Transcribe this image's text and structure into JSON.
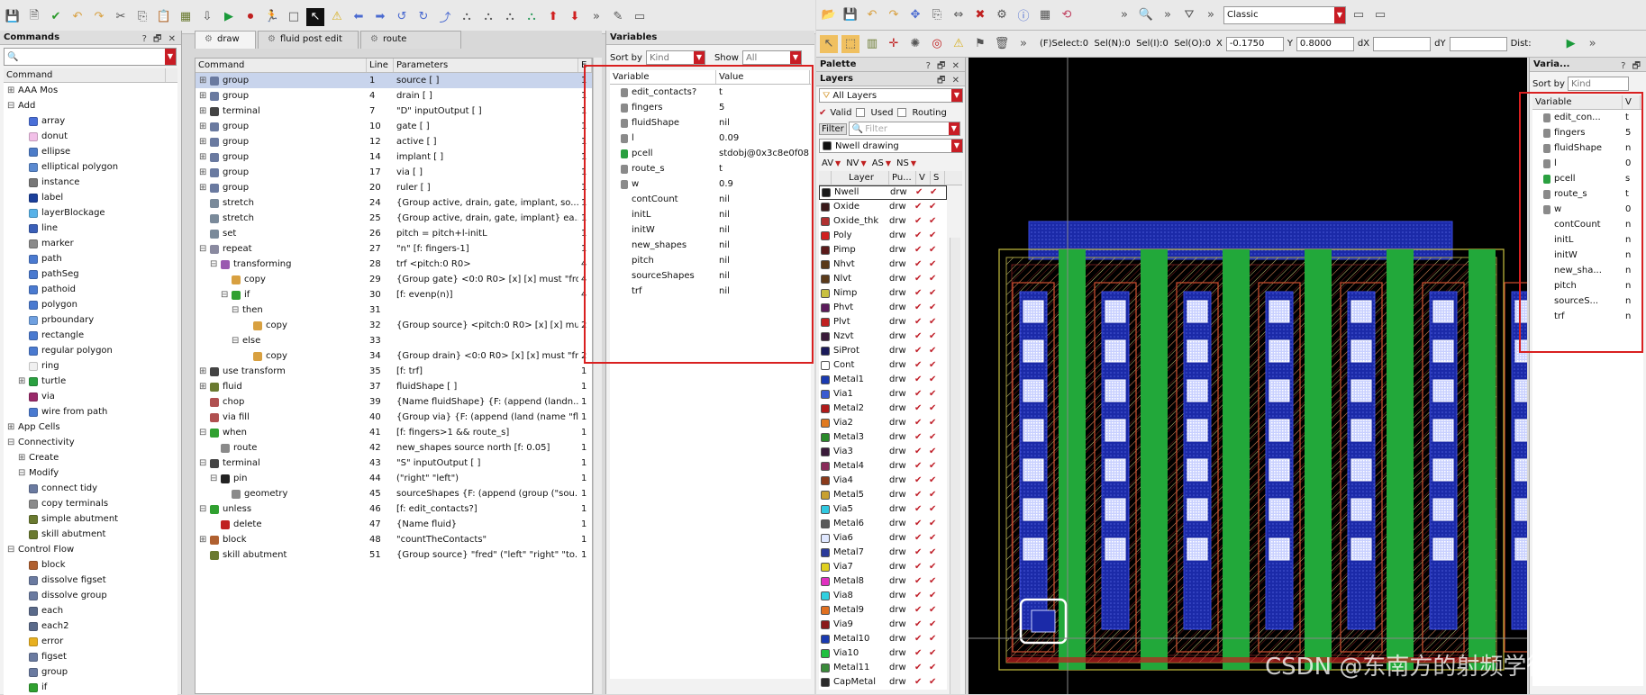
{
  "colors": {
    "accent_red": "#d92020",
    "canvas_bg": "#000000",
    "green_layer": "#22a83a",
    "blue_layer": "#1b2aa8"
  },
  "commands_panel": {
    "title": "Commands",
    "search_placeholder": "",
    "column": "Command",
    "items": [
      {
        "label": "AAA Mos",
        "indent": 0,
        "exp": "+",
        "icon": ""
      },
      {
        "label": "Add",
        "indent": 0,
        "exp": "−",
        "icon": ""
      },
      {
        "label": "array",
        "indent": 2,
        "exp": "",
        "icon": "#4a6fd8"
      },
      {
        "label": "donut",
        "indent": 2,
        "exp": "",
        "icon": "#f2c0e8"
      },
      {
        "label": "ellipse",
        "indent": 2,
        "exp": "",
        "icon": "#4d7cc8"
      },
      {
        "label": "elliptical polygon",
        "indent": 2,
        "exp": "",
        "icon": "#5b8ad0"
      },
      {
        "label": "instance",
        "indent": 2,
        "exp": "",
        "icon": "#777777"
      },
      {
        "label": "label",
        "indent": 2,
        "exp": "",
        "icon": "#1b3f9a"
      },
      {
        "label": "layerBlockage",
        "indent": 2,
        "exp": "",
        "icon": "#58b2e8"
      },
      {
        "label": "line",
        "indent": 2,
        "exp": "",
        "icon": "#3a5fb8"
      },
      {
        "label": "marker",
        "indent": 2,
        "exp": "",
        "icon": "#8a8a8a"
      },
      {
        "label": "path",
        "indent": 2,
        "exp": "",
        "icon": "#4a7ad0"
      },
      {
        "label": "pathSeg",
        "indent": 2,
        "exp": "",
        "icon": "#4a7ad0"
      },
      {
        "label": "pathoid",
        "indent": 2,
        "exp": "",
        "icon": "#4a7ad0"
      },
      {
        "label": "polygon",
        "indent": 2,
        "exp": "",
        "icon": "#4a7ad0"
      },
      {
        "label": "prboundary",
        "indent": 2,
        "exp": "",
        "icon": "#6fa0e0"
      },
      {
        "label": "rectangle",
        "indent": 2,
        "exp": "",
        "icon": "#4a7ad0"
      },
      {
        "label": "regular polygon",
        "indent": 2,
        "exp": "",
        "icon": "#4a7ad0"
      },
      {
        "label": "ring",
        "indent": 2,
        "exp": "",
        "icon": "#f0f0f0"
      },
      {
        "label": "turtle",
        "indent": 1,
        "exp": "+",
        "icon": "#2aa040"
      },
      {
        "label": "via",
        "indent": 2,
        "exp": "",
        "icon": "#9a2a6a"
      },
      {
        "label": "wire from path",
        "indent": 2,
        "exp": "",
        "icon": "#4a7ad0"
      },
      {
        "label": "App Cells",
        "indent": 0,
        "exp": "+",
        "icon": ""
      },
      {
        "label": "Connectivity",
        "indent": 0,
        "exp": "−",
        "icon": ""
      },
      {
        "label": "Create",
        "indent": 1,
        "exp": "+",
        "icon": ""
      },
      {
        "label": "Modify",
        "indent": 1,
        "exp": "−",
        "icon": ""
      },
      {
        "label": "connect tidy",
        "indent": 2,
        "exp": "",
        "icon": "#6a7aa0"
      },
      {
        "label": "copy terminals",
        "indent": 2,
        "exp": "",
        "icon": "#8a8a8a"
      },
      {
        "label": "simple abutment",
        "indent": 2,
        "exp": "",
        "icon": "#6a7a30"
      },
      {
        "label": "skill abutment",
        "indent": 2,
        "exp": "",
        "icon": "#6a7a30"
      },
      {
        "label": "Control Flow",
        "indent": 0,
        "exp": "−",
        "icon": ""
      },
      {
        "label": "block",
        "indent": 2,
        "exp": "",
        "icon": "#b06030"
      },
      {
        "label": "dissolve figset",
        "indent": 2,
        "exp": "",
        "icon": "#6a7aa0"
      },
      {
        "label": "dissolve group",
        "indent": 2,
        "exp": "",
        "icon": "#6a7aa0"
      },
      {
        "label": "each",
        "indent": 2,
        "exp": "",
        "icon": "#5a6a8a"
      },
      {
        "label": "each2",
        "indent": 2,
        "exp": "",
        "icon": "#5a6a8a"
      },
      {
        "label": "error",
        "indent": 2,
        "exp": "",
        "icon": "#e8b020"
      },
      {
        "label": "figset",
        "indent": 2,
        "exp": "",
        "icon": "#6a7aa0"
      },
      {
        "label": "group",
        "indent": 2,
        "exp": "",
        "icon": "#6a7aa0"
      },
      {
        "label": "if",
        "indent": 2,
        "exp": "",
        "icon": "#30a030"
      }
    ]
  },
  "tabs": [
    {
      "label": "draw",
      "active": true
    },
    {
      "label": "fluid post edit",
      "active": false
    },
    {
      "label": "route",
      "active": false
    }
  ],
  "command_table": {
    "columns": [
      "Command",
      "Line",
      "Parameters",
      "E"
    ],
    "rows": [
      {
        "cmd": "group",
        "indent": 0,
        "exp": "+",
        "line": "1",
        "params": "source [ ]",
        "e": "1",
        "sel": true,
        "icon": "#6a7aa0"
      },
      {
        "cmd": "group",
        "indent": 0,
        "exp": "+",
        "line": "4",
        "params": "drain [ ]",
        "e": "1",
        "icon": "#6a7aa0"
      },
      {
        "cmd": "terminal",
        "indent": 0,
        "exp": "+",
        "line": "7",
        "params": "\"D\" inputOutput [ ]",
        "e": "1",
        "icon": "#444444"
      },
      {
        "cmd": "group",
        "indent": 0,
        "exp": "+",
        "line": "10",
        "params": "gate [ ]",
        "e": "1",
        "icon": "#6a7aa0"
      },
      {
        "cmd": "group",
        "indent": 0,
        "exp": "+",
        "line": "12",
        "params": "active [ ]",
        "e": "1",
        "icon": "#6a7aa0"
      },
      {
        "cmd": "group",
        "indent": 0,
        "exp": "+",
        "line": "14",
        "params": "implant [ ]",
        "e": "1",
        "icon": "#6a7aa0"
      },
      {
        "cmd": "group",
        "indent": 0,
        "exp": "+",
        "line": "17",
        "params": "via [ ]",
        "e": "1",
        "icon": "#6a7aa0"
      },
      {
        "cmd": "group",
        "indent": 0,
        "exp": "+",
        "line": "20",
        "params": "ruler [ ]",
        "e": "1",
        "icon": "#6a7aa0"
      },
      {
        "cmd": "stretch",
        "indent": 0,
        "exp": "",
        "line": "24",
        "params": "{Group active, drain, gate, implant, so...",
        "e": "1",
        "icon": "#7a8a9a"
      },
      {
        "cmd": "stretch",
        "indent": 0,
        "exp": "",
        "line": "25",
        "params": "{Group active, drain, gate, implant} ea...",
        "e": "1",
        "icon": "#7a8a9a"
      },
      {
        "cmd": "set",
        "indent": 0,
        "exp": "",
        "line": "26",
        "params": "pitch = pitch+l-initL",
        "e": "1",
        "icon": "#7a8a9a"
      },
      {
        "cmd": "repeat",
        "indent": 0,
        "exp": "−",
        "line": "27",
        "params": "\"n\" [f: fingers-1]",
        "e": "1",
        "icon": "#8a8aa0"
      },
      {
        "cmd": "transforming",
        "indent": 1,
        "exp": "−",
        "line": "28",
        "params": "trf <pitch:0 R0>",
        "e": "4",
        "icon": "#9a5ab0"
      },
      {
        "cmd": "copy",
        "indent": 2,
        "exp": "",
        "line": "29",
        "params": "{Group gate} <0:0 R0> [x] [x] must \"fro...",
        "e": "4",
        "icon": "#d8a040"
      },
      {
        "cmd": "if",
        "indent": 2,
        "exp": "−",
        "line": "30",
        "params": "[f: evenp(n)]",
        "e": "4",
        "icon": "#30a030"
      },
      {
        "cmd": "then",
        "indent": 3,
        "exp": "−",
        "line": "31",
        "params": "",
        "e": "",
        "icon": ""
      },
      {
        "cmd": "copy",
        "indent": 4,
        "exp": "",
        "line": "32",
        "params": "{Group source} <pitch:0 R0> [x] [x] mu...",
        "e": "2",
        "icon": "#d8a040"
      },
      {
        "cmd": "else",
        "indent": 3,
        "exp": "−",
        "line": "33",
        "params": "",
        "e": "",
        "icon": ""
      },
      {
        "cmd": "copy",
        "indent": 4,
        "exp": "",
        "line": "34",
        "params": "{Group drain} <0:0 R0> [x] [x] must \"fr...",
        "e": "2",
        "icon": "#d8a040"
      },
      {
        "cmd": "use transform",
        "indent": 0,
        "exp": "+",
        "line": "35",
        "params": "[f: trf]",
        "e": "1",
        "icon": "#444444"
      },
      {
        "cmd": "fluid",
        "indent": 0,
        "exp": "+",
        "line": "37",
        "params": "fluidShape [ ]",
        "e": "1",
        "icon": "#6a7a30"
      },
      {
        "cmd": "chop",
        "indent": 0,
        "exp": "",
        "line": "39",
        "params": "{Name fluidShape} {F: (append (landn...",
        "e": "1",
        "icon": "#b05050"
      },
      {
        "cmd": "via fill",
        "indent": 0,
        "exp": "",
        "line": "40",
        "params": "{Group via} {F: (append (land (name \"fl...",
        "e": "1",
        "icon": "#b05050"
      },
      {
        "cmd": "when",
        "indent": 0,
        "exp": "−",
        "line": "41",
        "params": "[f: fingers>1 && route_s]",
        "e": "1",
        "icon": "#30a030"
      },
      {
        "cmd": "route",
        "indent": 1,
        "exp": "",
        "line": "42",
        "params": "new_shapes source north [f: 0.05]",
        "e": "1",
        "icon": "#8a8a8a"
      },
      {
        "cmd": "terminal",
        "indent": 0,
        "exp": "−",
        "line": "43",
        "params": "\"S\" inputOutput [ ]",
        "e": "1",
        "icon": "#444444"
      },
      {
        "cmd": "pin",
        "indent": 1,
        "exp": "−",
        "line": "44",
        "params": "(\"right\" \"left\")",
        "e": "1",
        "icon": "#222222"
      },
      {
        "cmd": "geometry",
        "indent": 2,
        "exp": "",
        "line": "45",
        "params": "sourceShapes {F: (append (group (\"sou...",
        "e": "1",
        "icon": "#8a8a8a"
      },
      {
        "cmd": "unless",
        "indent": 0,
        "exp": "−",
        "line": "46",
        "params": "[f: edit_contacts?]",
        "e": "1",
        "icon": "#30a030"
      },
      {
        "cmd": "delete",
        "indent": 1,
        "exp": "",
        "line": "47",
        "params": "{Name fluid}",
        "e": "1",
        "icon": "#c02020"
      },
      {
        "cmd": "block",
        "indent": 0,
        "exp": "+",
        "line": "48",
        "params": "\"countTheContacts\"",
        "e": "1",
        "icon": "#b06030"
      },
      {
        "cmd": "skill abutment",
        "indent": 0,
        "exp": "",
        "line": "51",
        "params": "{Group source} \"fred\" (\"left\" \"right\" \"to...",
        "e": "1",
        "icon": "#6a7a30"
      }
    ]
  },
  "variables_panel": {
    "title": "Variables",
    "sort_label": "Sort by",
    "sort_value": "Kind",
    "show_label": "Show",
    "show_value": "All",
    "columns": [
      "Variable",
      "Value"
    ],
    "rows": [
      {
        "name": "edit_contacts?",
        "value": "t",
        "icon": "#8a8a8a"
      },
      {
        "name": "fingers",
        "value": "5",
        "icon": "#8a8a8a"
      },
      {
        "name": "fluidShape",
        "value": "nil",
        "icon": "#8a8a8a"
      },
      {
        "name": "l",
        "value": "0.09",
        "icon": "#8a8a8a"
      },
      {
        "name": "pcell",
        "value": "stdobj@0x3c8e0f08",
        "icon": "#2aa040"
      },
      {
        "name": "route_s",
        "value": "t",
        "icon": "#8a8a8a"
      },
      {
        "name": "w",
        "value": "0.9",
        "icon": "#8a8a8a"
      },
      {
        "name": "contCount",
        "value": "nil",
        "icon": ""
      },
      {
        "name": "initL",
        "value": "nil",
        "icon": ""
      },
      {
        "name": "initW",
        "value": "nil",
        "icon": ""
      },
      {
        "name": "new_shapes",
        "value": "nil",
        "icon": ""
      },
      {
        "name": "pitch",
        "value": "nil",
        "icon": ""
      },
      {
        "name": "sourceShapes",
        "value": "nil",
        "icon": ""
      },
      {
        "name": "trf",
        "value": "nil",
        "icon": ""
      }
    ]
  },
  "right_toolbar": {
    "theme_value": "Classic",
    "select_status": "(F)Select:0  Sel(N):0  Sel(I):0  Sel(O):0",
    "x_label": "X",
    "x_value": "-0.1750",
    "y_label": "Y",
    "y_value": "0.8000",
    "dx_label": "dX",
    "dy_label": "dY",
    "dist_label": "Dist:"
  },
  "palette_panel": {
    "title": "Palette",
    "layers_title": "Layers",
    "all_layers": "All Layers",
    "valid": "Valid",
    "used": "Used",
    "routing": "Routing",
    "filter_label": "Filter",
    "filter_placeholder": "Filter",
    "current_layer": "Nwell drawing",
    "visibility_buttons": [
      "AV",
      "NV",
      "AS",
      "NS"
    ],
    "columns": [
      "Layer",
      "Pu...",
      "V",
      "S"
    ],
    "layers": [
      {
        "name": "Nwell",
        "purpose": "drw",
        "color": "#1a1a1a"
      },
      {
        "name": "Oxide",
        "purpose": "drw",
        "color": "#3a1a1a"
      },
      {
        "name": "Oxide_thk",
        "purpose": "drw",
        "color": "#b03030"
      },
      {
        "name": "Poly",
        "purpose": "drw",
        "color": "#d02020"
      },
      {
        "name": "Pimp",
        "purpose": "drw",
        "color": "#5a1a1a"
      },
      {
        "name": "Nhvt",
        "purpose": "drw",
        "color": "#5a3a1a"
      },
      {
        "name": "Nlvt",
        "purpose": "drw",
        "color": "#5a3a1a"
      },
      {
        "name": "Nimp",
        "purpose": "drw",
        "color": "#c8c040"
      },
      {
        "name": "Phvt",
        "purpose": "drw",
        "color": "#5a1a5a"
      },
      {
        "name": "Plvt",
        "purpose": "drw",
        "color": "#c02020"
      },
      {
        "name": "Nzvt",
        "purpose": "drw",
        "color": "#3a1a3a"
      },
      {
        "name": "SiProt",
        "purpose": "drw",
        "color": "#1a1a5a"
      },
      {
        "name": "Cont",
        "purpose": "drw",
        "color": "#ffffff"
      },
      {
        "name": "Metal1",
        "purpose": "drw",
        "color": "#1a3ab0"
      },
      {
        "name": "Via1",
        "purpose": "drw",
        "color": "#3a5ad0"
      },
      {
        "name": "Metal2",
        "purpose": "drw",
        "color": "#b01a1a"
      },
      {
        "name": "Via2",
        "purpose": "drw",
        "color": "#e07a20"
      },
      {
        "name": "Metal3",
        "purpose": "drw",
        "color": "#2a8a2a"
      },
      {
        "name": "Via3",
        "purpose": "drw",
        "color": "#3a1a3a"
      },
      {
        "name": "Metal4",
        "purpose": "drw",
        "color": "#8a2a5a"
      },
      {
        "name": "Via4",
        "purpose": "drw",
        "color": "#8a3a1a"
      },
      {
        "name": "Metal5",
        "purpose": "drw",
        "color": "#c8a030"
      },
      {
        "name": "Via5",
        "purpose": "drw",
        "color": "#30c8e0"
      },
      {
        "name": "Metal6",
        "purpose": "drw",
        "color": "#5a5a5a"
      },
      {
        "name": "Via6",
        "purpose": "drw",
        "color": "#e0e8ff"
      },
      {
        "name": "Metal7",
        "purpose": "drw",
        "color": "#2a3a9a"
      },
      {
        "name": "Via7",
        "purpose": "drw",
        "color": "#e0d020"
      },
      {
        "name": "Metal8",
        "purpose": "drw",
        "color": "#e030c0"
      },
      {
        "name": "Via8",
        "purpose": "drw",
        "color": "#30d0e0"
      },
      {
        "name": "Metal9",
        "purpose": "drw",
        "color": "#e07020"
      },
      {
        "name": "Via9",
        "purpose": "drw",
        "color": "#8a1a1a"
      },
      {
        "name": "Metal10",
        "purpose": "drw",
        "color": "#1a3ab0"
      },
      {
        "name": "Via10",
        "purpose": "drw",
        "color": "#20c040"
      },
      {
        "name": "Metal11",
        "purpose": "drw",
        "color": "#3a8a3a"
      },
      {
        "name": "CapMetal",
        "purpose": "drw",
        "color": "#2a2a2a"
      }
    ]
  },
  "right_variables_panel": {
    "title": "Varia...",
    "sort_label": "Sort by",
    "sort_value": "Kind",
    "column": "Variable",
    "column2": "V",
    "rows": [
      {
        "name": "edit_con...",
        "value": "t",
        "icon": "#8a8a8a"
      },
      {
        "name": "fingers",
        "value": "5",
        "icon": "#8a8a8a"
      },
      {
        "name": "fluidShape",
        "value": "n",
        "icon": "#8a8a8a"
      },
      {
        "name": "l",
        "value": "0",
        "icon": "#8a8a8a"
      },
      {
        "name": "pcell",
        "value": "s",
        "icon": "#2aa040"
      },
      {
        "name": "route_s",
        "value": "t",
        "icon": "#8a8a8a"
      },
      {
        "name": "w",
        "value": "0",
        "icon": "#8a8a8a"
      },
      {
        "name": "contCount",
        "value": "n",
        "icon": ""
      },
      {
        "name": "initL",
        "value": "n",
        "icon": ""
      },
      {
        "name": "initW",
        "value": "n",
        "icon": ""
      },
      {
        "name": "new_sha...",
        "value": "n",
        "icon": ""
      },
      {
        "name": "pitch",
        "value": "n",
        "icon": ""
      },
      {
        "name": "sourceS...",
        "value": "n",
        "icon": ""
      },
      {
        "name": "trf",
        "value": "n",
        "icon": ""
      }
    ]
  },
  "layout": {
    "finger_count": 5,
    "contacts_per_column": 7
  },
  "watermark": "CSDN @东南方的射频学徒"
}
